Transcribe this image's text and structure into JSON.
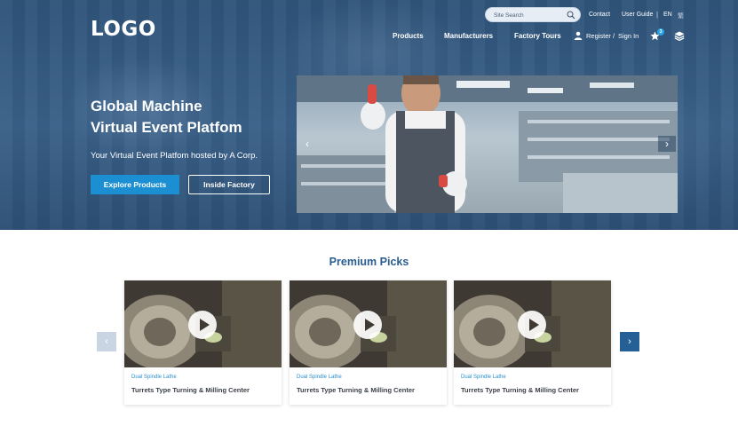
{
  "header": {
    "logo": "LOGO",
    "search": {
      "placeholder": "Site Search"
    },
    "top_links": {
      "contact": "Contact",
      "user_guide": "User Guide",
      "lang": "EN",
      "lang_alt": "繁"
    },
    "nav": {
      "products": "Products",
      "manufacturers": "Manufacturers",
      "factory_tours": "Factory Tours"
    },
    "account": {
      "register": "Register",
      "divider": "/",
      "sign_in": "Sign In"
    },
    "favorites_count": "3"
  },
  "hero": {
    "title_line1": "Global Machine",
    "title_line2": "Virtual Event Platfom",
    "subtitle": "Your Virtual Event Platfom hosted by A Corp.",
    "primary_button": "Explore Products",
    "secondary_button": "Inside Factory",
    "slider_prev": "‹",
    "slider_next": "›"
  },
  "premium": {
    "title": "Premium Picks",
    "prev": "‹",
    "next": "›",
    "cards": [
      {
        "category": "Dual Spindle Lathe",
        "title": "Turrets Type Turning & Milling Center"
      },
      {
        "category": "Dual Spindle Lathe",
        "title": "Turrets Type Turning & Milling Center"
      },
      {
        "category": "Dual Spindle Lathe",
        "title": "Turrets Type Turning & Milling Center"
      }
    ]
  },
  "icons": [
    "search-icon",
    "user-icon",
    "star-icon",
    "layers-icon",
    "play-icon",
    "chevron-left-icon",
    "chevron-right-icon"
  ],
  "colors": {
    "hero": "#34597f",
    "primary": "#1c8fd3",
    "title": "#2a5d8f",
    "next_button": "#245f95",
    "prev_button": "#c9d5e3"
  }
}
